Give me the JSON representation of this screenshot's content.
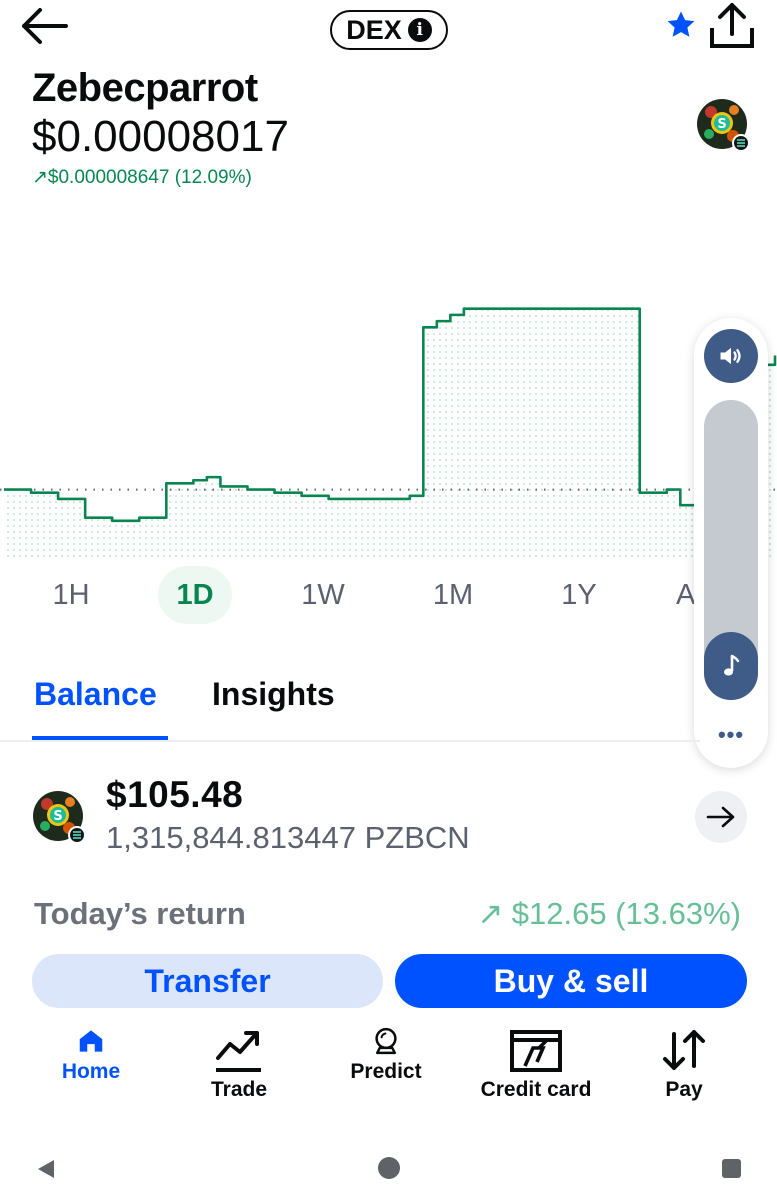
{
  "header": {
    "dex_label": "DEX",
    "info_glyph": "i",
    "back_icon": "back-arrow-icon",
    "star_icon": "star-icon",
    "share_icon": "share-icon"
  },
  "token": {
    "name": "Zebecparrot",
    "price": "$0.00008017",
    "change": "↗$0.000008647 (12.09%)"
  },
  "chart_data": {
    "type": "line",
    "color": "#098551",
    "baseline_visible": true,
    "ylim": [
      0,
      100
    ],
    "values": [
      20,
      20,
      19,
      19,
      17,
      17,
      11,
      11,
      10,
      10,
      11,
      11,
      22,
      22,
      23,
      24,
      21,
      21,
      20,
      20,
      19,
      19,
      18,
      18,
      17,
      17,
      17,
      17,
      17,
      17,
      18,
      72,
      74,
      76,
      78,
      78,
      78,
      78,
      78,
      78,
      78,
      78,
      78,
      78,
      78,
      78,
      78,
      19,
      19,
      20,
      15,
      15,
      13,
      13,
      14,
      60,
      60,
      63
    ]
  },
  "ranges": [
    "1H",
    "1D",
    "1W",
    "1M",
    "1Y",
    "All"
  ],
  "active_range": "1D",
  "volume": {
    "more": "•••",
    "level": 0.2
  },
  "tabs": {
    "balance": "Balance",
    "insights": "Insights"
  },
  "balance": {
    "value": "$105.48",
    "amount": "1,315,844.813447 PZBCN",
    "return_label": "Today’s return",
    "return_value": "↗ $12.65 (13.63%)"
  },
  "actions": {
    "transfer": "Transfer",
    "buy_sell": "Buy & sell"
  },
  "nav": {
    "home": "Home",
    "trade": "Trade",
    "predict": "Predict",
    "credit_card": "Credit card",
    "pay": "Pay"
  },
  "colors": {
    "brand_blue": "#0052ff",
    "positive_green": "#098551",
    "return_green": "#67bf98"
  }
}
